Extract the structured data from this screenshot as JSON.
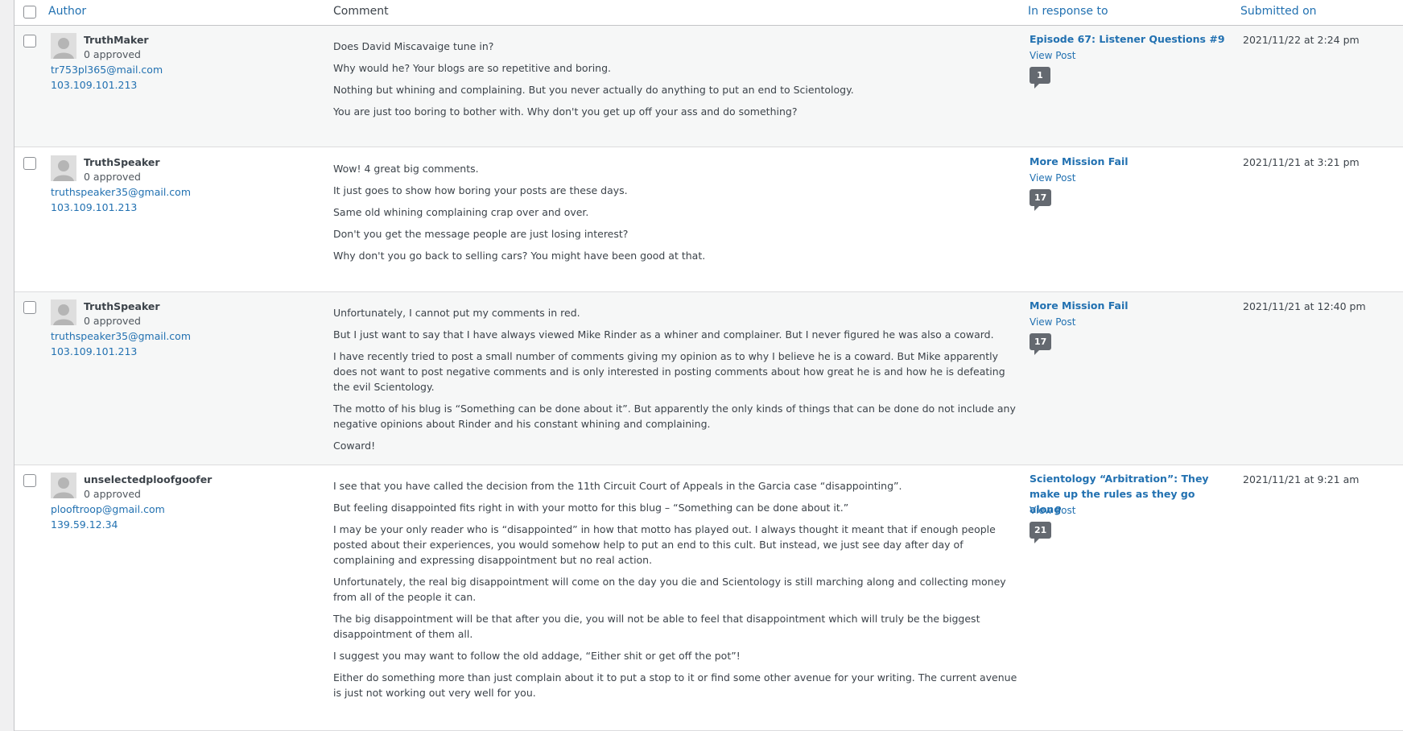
{
  "header": {
    "author": "Author",
    "comment": "Comment",
    "in_response_to": "In response to",
    "submitted_on": "Submitted on"
  },
  "comments": [
    {
      "author": "TruthMaker",
      "approved": "0 approved",
      "email": "tr753pl365@mail.com",
      "ip": "103.109.101.213",
      "paragraphs": [
        "Does David Miscavaige tune in?",
        "Why would he? Your blogs are so repetitive and boring.",
        "Nothing but whining and complaining. But you never actually do anything to put an end to Scientology.",
        "You are just too boring to bother with. Why don't you get up off your ass and do something?"
      ],
      "post_title": "Episode 67: Listener Questions #9",
      "view_post": "View Post",
      "count": "1",
      "date": "2021/11/22 at 2:24 pm"
    },
    {
      "author": "TruthSpeaker",
      "approved": "0 approved",
      "email": "truthspeaker35@gmail.com",
      "ip": "103.109.101.213",
      "paragraphs": [
        "Wow! 4 great big comments.",
        "It just goes to show how boring your posts are these days.",
        "Same old whining complaining crap over and over.",
        "Don't you get the message people are just losing interest?",
        "Why don't you go back to selling cars? You might have been good at that."
      ],
      "post_title": "More Mission Fail",
      "view_post": "View Post",
      "count": "17",
      "date": "2021/11/21 at 3:21 pm"
    },
    {
      "author": "TruthSpeaker",
      "approved": "0 approved",
      "email": "truthspeaker35@gmail.com",
      "ip": "103.109.101.213",
      "paragraphs": [
        "Unfortunately, I cannot put my comments in red.",
        "But I just want to say that I have always viewed Mike Rinder as a whiner and complainer. But I never figured he was also a coward.",
        "I have recently tried to post a small number of comments giving my opinion as to why I believe he is a coward. But Mike apparently does not want to post negative comments and is only interested in posting comments about how great he is and how he is defeating the evil Scientology.",
        "The motto of his blug is “Something can be done about it”. But apparently the only kinds of things that can be done do not include any negative opinions about Rinder and his constant whining and complaining.",
        "Coward!"
      ],
      "post_title": "More Mission Fail",
      "view_post": "View Post",
      "count": "17",
      "date": "2021/11/21 at 12:40 pm"
    },
    {
      "author": "unselectedploofgoofer",
      "approved": "0 approved",
      "email": "plooftroop@gmail.com",
      "ip": "139.59.12.34",
      "paragraphs": [
        "I see that you have called the decision from the 11th Circuit Court of Appeals in the Garcia case “disappointing”.",
        "But feeling disappointed fits right in with your motto for this blug – “Something can be done about it.”",
        "I may be your only reader who is “disappointed” in how that motto has played out. I always thought it meant that if enough people posted about their experiences, you would somehow help to put an end to this cult. But instead, we just see day after day of complaining and expressing disappointment but no real action.",
        "Unfortunately, the real big disappointment will come on the day you die and Scientology is still marching along and collecting money from all of the people it can.",
        "The big disappointment will be that after you die, you will not be able to feel that disappointment which will truly be the biggest disappointment of them all.",
        "I suggest you may want to follow the old addage, “Either shit or get off the pot”!",
        "Either do something more than just complain about it to put a stop to it or find some other avenue for your writing. The current avenue is just not working out very well for you."
      ],
      "post_title": "Scientology “Arbitration”: They make up the rules as they go along",
      "view_post": "View Post",
      "count": "21",
      "date": "2021/11/21 at 9:21 am"
    }
  ]
}
